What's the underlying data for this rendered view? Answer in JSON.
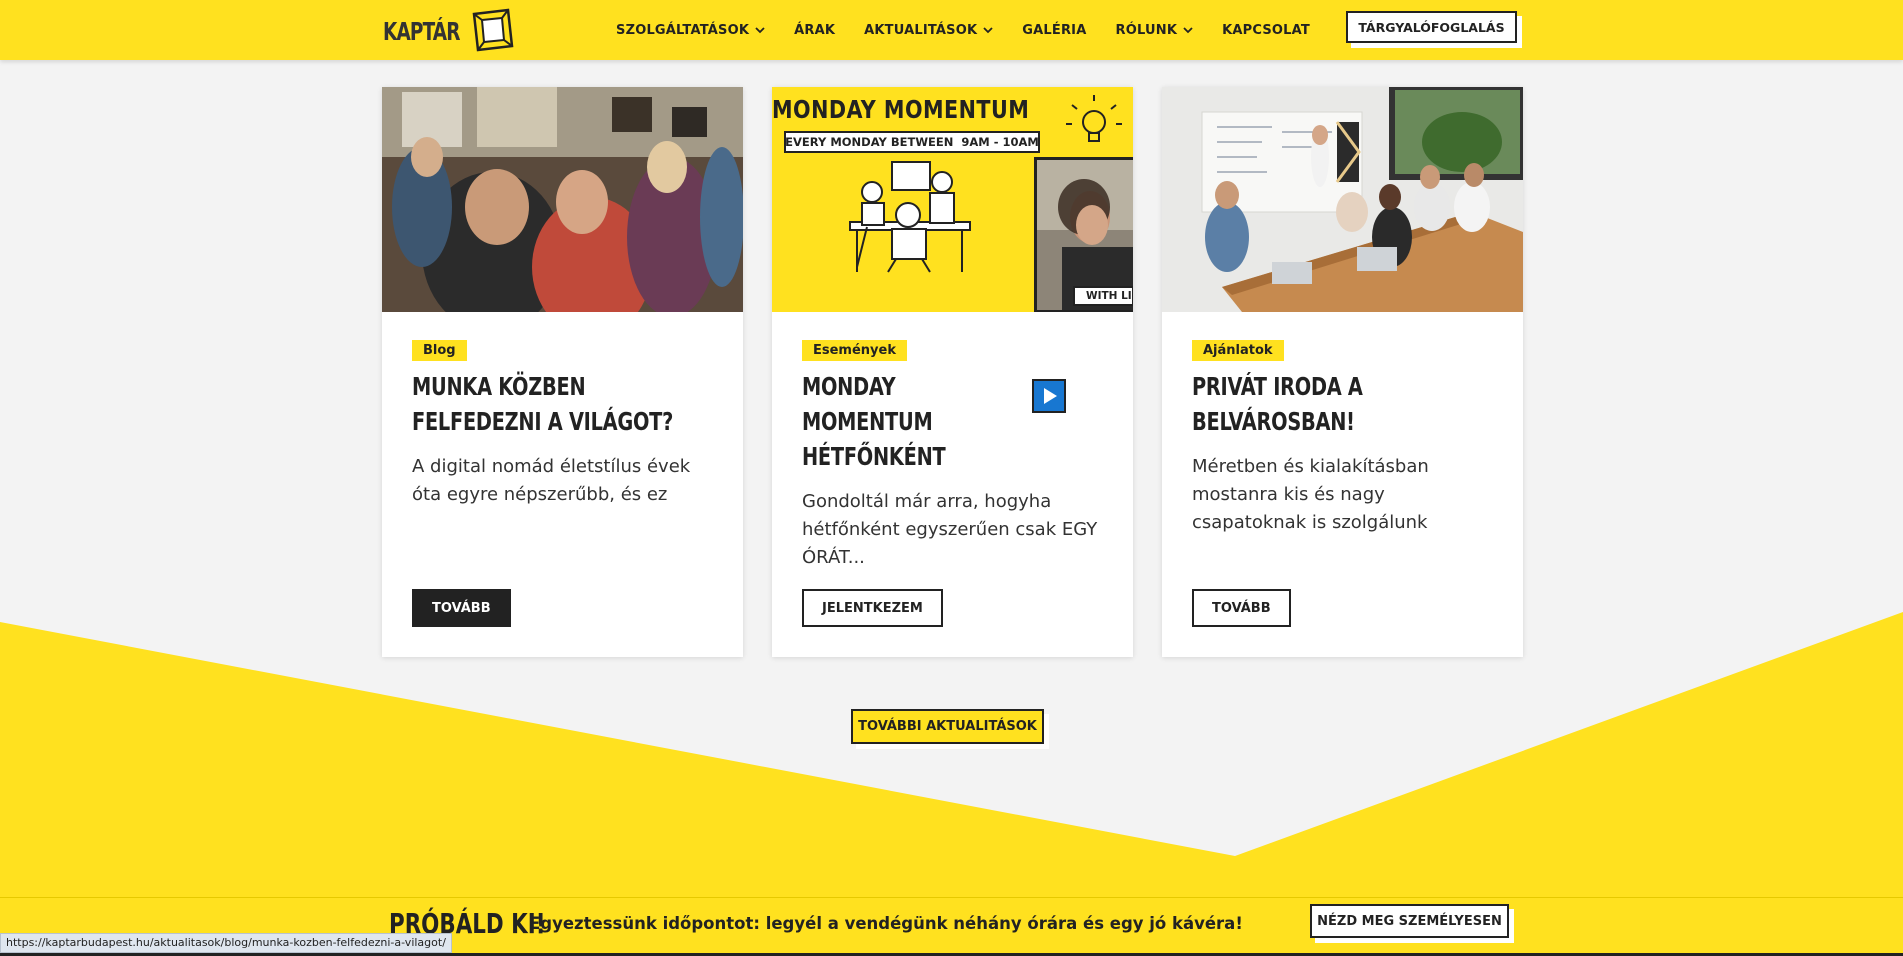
{
  "header": {
    "logo_text": "KAPTÁR",
    "nav": [
      {
        "label": "SZOLGÁLTATÁSOK",
        "dropdown": true
      },
      {
        "label": "ÁRAK",
        "dropdown": false
      },
      {
        "label": "AKTUALITÁSOK",
        "dropdown": true
      },
      {
        "label": "GALÉRIA",
        "dropdown": false
      },
      {
        "label": "RÓLUNK",
        "dropdown": true
      },
      {
        "label": "KAPCSOLAT",
        "dropdown": false
      }
    ],
    "cta_label": "TÁRGYALÓFOGLALÁS"
  },
  "cards": [
    {
      "tag": "Blog",
      "title": "MUNKA KÖZBEN FELFEDEZNI A VILÁGOT?",
      "text": "A digital nomád életstílus évek óta egyre népszerűbb, és ez",
      "button": "TOVÁBB"
    },
    {
      "tag": "Események",
      "title": "MONDAY MOMENTUM HÉTFŐNKÉNT",
      "text": "Gondoltál már arra, hogyha hétfőnként egyszerűen csak EGY ÓRÁT...",
      "button": "JELENTKEZEM",
      "image_heading": "MONDAY MOMENTUM",
      "image_sub": "EVERY MONDAY BETWEEN  9AM - 10AM",
      "image_badge": "WITH LI"
    },
    {
      "tag": "Ajánlatok",
      "title": "PRIVÁT IRODA A BELVÁROSBAN!",
      "text": "Méretben és kialakításban mostanra kis és nagy csapatoknak is szolgálunk",
      "button": "TOVÁBB"
    }
  ],
  "more_button": "TOVÁBBI AKTUALITÁSOK",
  "banner": {
    "title": "PRÓBÁLD KI!",
    "text": "Egyeztessünk időpontot: legyél a vendégünk néhány órára és egy jó kávéra!",
    "button": "NÉZD MEG SZEMÉLYESEN"
  },
  "status_url": "https://kaptarbudapest.hu/aktualitasok/blog/munka-kozben-felfedezni-a-vilagot/",
  "colors": {
    "brand_yellow": "#ffe11f",
    "dark": "#222222",
    "background": "#f3f3f3"
  }
}
